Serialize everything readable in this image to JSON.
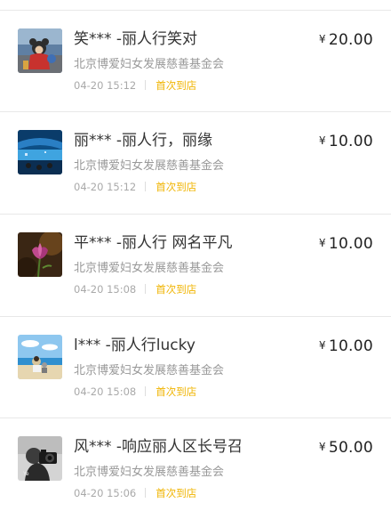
{
  "donations": [
    {
      "name": "笑*** -丽人行笑对",
      "org": "北京博爱妇女发展慈善基金会",
      "time": "04-20 15:12",
      "tag": "首次到店",
      "currency": "¥",
      "amount": "20.00",
      "avatar": "avatar-photo-mascot"
    },
    {
      "name": "丽*** -丽人行，丽缘",
      "org": "北京博爱妇女发展慈善基金会",
      "time": "04-20 15:12",
      "tag": "首次到店",
      "currency": "¥",
      "amount": "10.00",
      "avatar": "avatar-photo-aquarium"
    },
    {
      "name": "平*** -丽人行 网名平凡",
      "org": "北京博爱妇女发展慈善基金会",
      "time": "04-20 15:08",
      "tag": "首次到店",
      "currency": "¥",
      "amount": "10.00",
      "avatar": "avatar-photo-flower"
    },
    {
      "name": "l*** -丽人行lucky",
      "org": "北京博爱妇女发展慈善基金会",
      "time": "04-20 15:08",
      "tag": "首次到店",
      "currency": "¥",
      "amount": "10.00",
      "avatar": "avatar-photo-beach"
    },
    {
      "name": "风*** -响应丽人区长号召",
      "org": "北京博爱妇女发展慈善基金会",
      "time": "04-20 15:06",
      "tag": "首次到店",
      "currency": "¥",
      "amount": "50.00",
      "avatar": "avatar-photo-camera-bw"
    }
  ],
  "colors": {
    "tag": "#f0b400",
    "divider": "#e8e8e8",
    "muted": "#999999"
  }
}
